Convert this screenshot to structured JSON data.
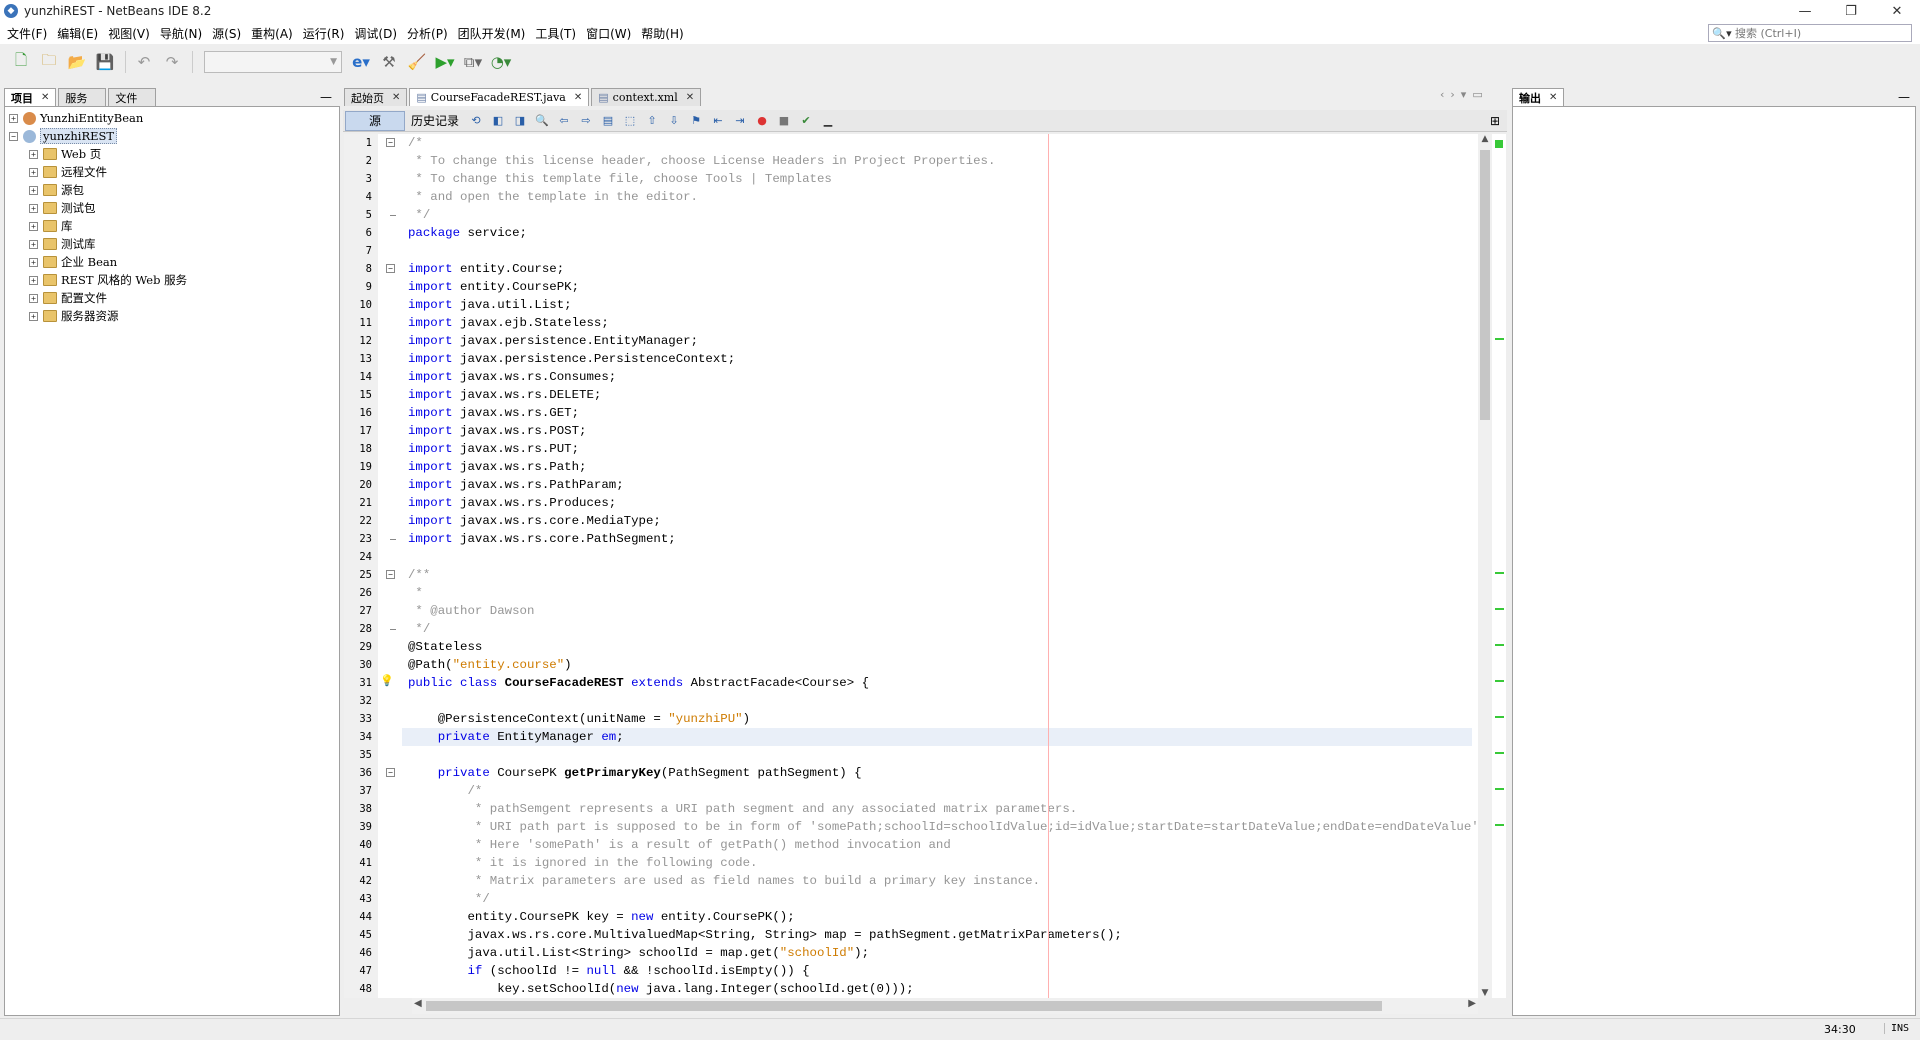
{
  "window": {
    "title": "yunzhiREST - NetBeans IDE 8.2",
    "minimize": "—",
    "restore": "❐",
    "close": "✕"
  },
  "menu": [
    "文件(F)",
    "编辑(E)",
    "视图(V)",
    "导航(N)",
    "源(S)",
    "重构(A)",
    "运行(R)",
    "调试(D)",
    "分析(P)",
    "团队开发(M)",
    "工具(T)",
    "窗口(W)",
    "帮助(H)"
  ],
  "search": {
    "placeholder": "搜索 (Ctrl+I)"
  },
  "left_panel": {
    "tabs": [
      "项目",
      "服务",
      "文件"
    ],
    "tree": [
      {
        "label": "YunzhiEntityBean",
        "level": 0,
        "expander": "+"
      },
      {
        "label": "yunzhiREST",
        "level": 0,
        "expander": "−",
        "selected": true
      },
      {
        "label": "Web 页",
        "level": 1,
        "expander": "+"
      },
      {
        "label": "远程文件",
        "level": 1,
        "expander": "+"
      },
      {
        "label": "源包",
        "level": 1,
        "expander": "+"
      },
      {
        "label": "测试包",
        "level": 1,
        "expander": "+"
      },
      {
        "label": "库",
        "level": 1,
        "expander": "+"
      },
      {
        "label": "测试库",
        "level": 1,
        "expander": "+"
      },
      {
        "label": "企业 Bean",
        "level": 1,
        "expander": "+"
      },
      {
        "label": "REST 风格的 Web 服务",
        "level": 1,
        "expander": "+"
      },
      {
        "label": "配置文件",
        "level": 1,
        "expander": "+"
      },
      {
        "label": "服务器资源",
        "level": 1,
        "expander": "+"
      }
    ]
  },
  "editor": {
    "tabs": [
      {
        "label": "起始页",
        "active": false
      },
      {
        "label": "CourseFacadeREST.java",
        "active": true
      },
      {
        "label": "context.xml",
        "active": false
      }
    ],
    "source_label": "源",
    "history_label": "历史记录",
    "lines": [
      [
        {
          "t": "/*",
          "c": "cm"
        }
      ],
      [
        {
          "t": " * To change this license header, choose License Headers in Project Properties.",
          "c": "cm"
        }
      ],
      [
        {
          "t": " * To change this template file, choose Tools | Templates",
          "c": "cm"
        }
      ],
      [
        {
          "t": " * and open the template in the editor.",
          "c": "cm"
        }
      ],
      [
        {
          "t": " */",
          "c": "cm"
        }
      ],
      [
        {
          "t": "package",
          "c": "kw"
        },
        {
          "t": " service;",
          "c": ""
        }
      ],
      [],
      [
        {
          "t": "import",
          "c": "kw"
        },
        {
          "t": " entity.Course;",
          "c": ""
        }
      ],
      [
        {
          "t": "import",
          "c": "kw"
        },
        {
          "t": " entity.CoursePK;",
          "c": ""
        }
      ],
      [
        {
          "t": "import",
          "c": "kw"
        },
        {
          "t": " java.util.List;",
          "c": ""
        }
      ],
      [
        {
          "t": "import",
          "c": "kw"
        },
        {
          "t": " javax.ejb.Stateless;",
          "c": ""
        }
      ],
      [
        {
          "t": "import",
          "c": "kw"
        },
        {
          "t": " javax.persistence.EntityManager;",
          "c": ""
        }
      ],
      [
        {
          "t": "import",
          "c": "kw"
        },
        {
          "t": " javax.persistence.PersistenceContext;",
          "c": ""
        }
      ],
      [
        {
          "t": "import",
          "c": "kw"
        },
        {
          "t": " javax.ws.rs.Consumes;",
          "c": ""
        }
      ],
      [
        {
          "t": "import",
          "c": "kw"
        },
        {
          "t": " javax.ws.rs.DELETE;",
          "c": ""
        }
      ],
      [
        {
          "t": "import",
          "c": "kw"
        },
        {
          "t": " javax.ws.rs.GET;",
          "c": ""
        }
      ],
      [
        {
          "t": "import",
          "c": "kw"
        },
        {
          "t": " javax.ws.rs.POST;",
          "c": ""
        }
      ],
      [
        {
          "t": "import",
          "c": "kw"
        },
        {
          "t": " javax.ws.rs.PUT;",
          "c": ""
        }
      ],
      [
        {
          "t": "import",
          "c": "kw"
        },
        {
          "t": " javax.ws.rs.Path;",
          "c": ""
        }
      ],
      [
        {
          "t": "import",
          "c": "kw"
        },
        {
          "t": " javax.ws.rs.PathParam;",
          "c": ""
        }
      ],
      [
        {
          "t": "import",
          "c": "kw"
        },
        {
          "t": " javax.ws.rs.Produces;",
          "c": ""
        }
      ],
      [
        {
          "t": "import",
          "c": "kw"
        },
        {
          "t": " javax.ws.rs.core.MediaType;",
          "c": ""
        }
      ],
      [
        {
          "t": "import",
          "c": "kw"
        },
        {
          "t": " javax.ws.rs.core.PathSegment;",
          "c": ""
        }
      ],
      [],
      [
        {
          "t": "/**",
          "c": "cm"
        }
      ],
      [
        {
          "t": " *",
          "c": "cm"
        }
      ],
      [
        {
          "t": " * @author Dawson",
          "c": "cm"
        }
      ],
      [
        {
          "t": " */",
          "c": "cm"
        }
      ],
      [
        {
          "t": "@Stateless",
          "c": ""
        }
      ],
      [
        {
          "t": "@Path(",
          "c": ""
        },
        {
          "t": "\"entity.course\"",
          "c": "str"
        },
        {
          "t": ")",
          "c": ""
        }
      ],
      [
        {
          "t": "public class",
          "c": "kw"
        },
        {
          "t": " ",
          "c": ""
        },
        {
          "t": "CourseFacadeREST",
          "c": "b"
        },
        {
          "t": " ",
          "c": ""
        },
        {
          "t": "extends",
          "c": "kw"
        },
        {
          "t": " AbstractFacade<Course> {",
          "c": ""
        }
      ],
      [],
      [
        {
          "t": "    @PersistenceContext(unitName = ",
          "c": ""
        },
        {
          "t": "\"yunzhiPU\"",
          "c": "str"
        },
        {
          "t": ")",
          "c": ""
        }
      ],
      [
        {
          "t": "    ",
          "c": ""
        },
        {
          "t": "private",
          "c": "kw"
        },
        {
          "t": " EntityManager ",
          "c": ""
        },
        {
          "t": "em",
          "c": "kw"
        },
        {
          "t": ";",
          "c": ""
        }
      ],
      [],
      [
        {
          "t": "    ",
          "c": ""
        },
        {
          "t": "private",
          "c": "kw"
        },
        {
          "t": " CoursePK ",
          "c": ""
        },
        {
          "t": "getPrimaryKey",
          "c": "b"
        },
        {
          "t": "(PathSegment pathSegment) {",
          "c": ""
        }
      ],
      [
        {
          "t": "        /*",
          "c": "cm"
        }
      ],
      [
        {
          "t": "         * pathSemgent represents a URI path segment and any associated matrix parameters.",
          "c": "cm"
        }
      ],
      [
        {
          "t": "         * URI path part is supposed to be in form of 'somePath;schoolId=schoolIdValue;id=idValue;startDate=startDateValue;endDate=endDateValue'.",
          "c": "cm"
        }
      ],
      [
        {
          "t": "         * Here 'somePath' is a result of getPath() method invocation and",
          "c": "cm"
        }
      ],
      [
        {
          "t": "         * it is ignored in the following code.",
          "c": "cm"
        }
      ],
      [
        {
          "t": "         * Matrix parameters are used as field names to build a primary key instance.",
          "c": "cm"
        }
      ],
      [
        {
          "t": "         */",
          "c": "cm"
        }
      ],
      [
        {
          "t": "        entity.CoursePK key = ",
          "c": ""
        },
        {
          "t": "new",
          "c": "kw"
        },
        {
          "t": " entity.CoursePK();",
          "c": ""
        }
      ],
      [
        {
          "t": "        javax.ws.rs.core.MultivaluedMap<String, String> map = pathSegment.getMatrixParameters();",
          "c": ""
        }
      ],
      [
        {
          "t": "        java.util.List<String> schoolId = map.get(",
          "c": ""
        },
        {
          "t": "\"schoolId\"",
          "c": "str"
        },
        {
          "t": ");",
          "c": ""
        }
      ],
      [
        {
          "t": "        ",
          "c": ""
        },
        {
          "t": "if",
          "c": "kw"
        },
        {
          "t": " (schoolId != ",
          "c": ""
        },
        {
          "t": "null",
          "c": "kw"
        },
        {
          "t": " && !schoolId.isEmpty()) {",
          "c": ""
        }
      ],
      [
        {
          "t": "            key.setSchoolId(",
          "c": ""
        },
        {
          "t": "new",
          "c": "kw"
        },
        {
          "t": " java.lang.Integer(schoolId.get(0)));",
          "c": ""
        }
      ]
    ],
    "highlight_line": 34,
    "fold_lines": [
      1,
      8,
      25,
      36
    ],
    "fold_end_lines": [
      5,
      23,
      28
    ],
    "bulb_line": 31,
    "error_marks_lines": [
      12,
      25,
      27,
      29,
      31,
      33,
      35,
      37,
      39
    ]
  },
  "right_panel": {
    "tab": "输出"
  },
  "status": {
    "position": "34:30",
    "mode": "INS"
  },
  "colors": {
    "keyword": "#0000e6",
    "comment": "#969696",
    "string": "#ce7b00",
    "highlight": "#e9eff8",
    "source_button": "#c9d9ee"
  }
}
